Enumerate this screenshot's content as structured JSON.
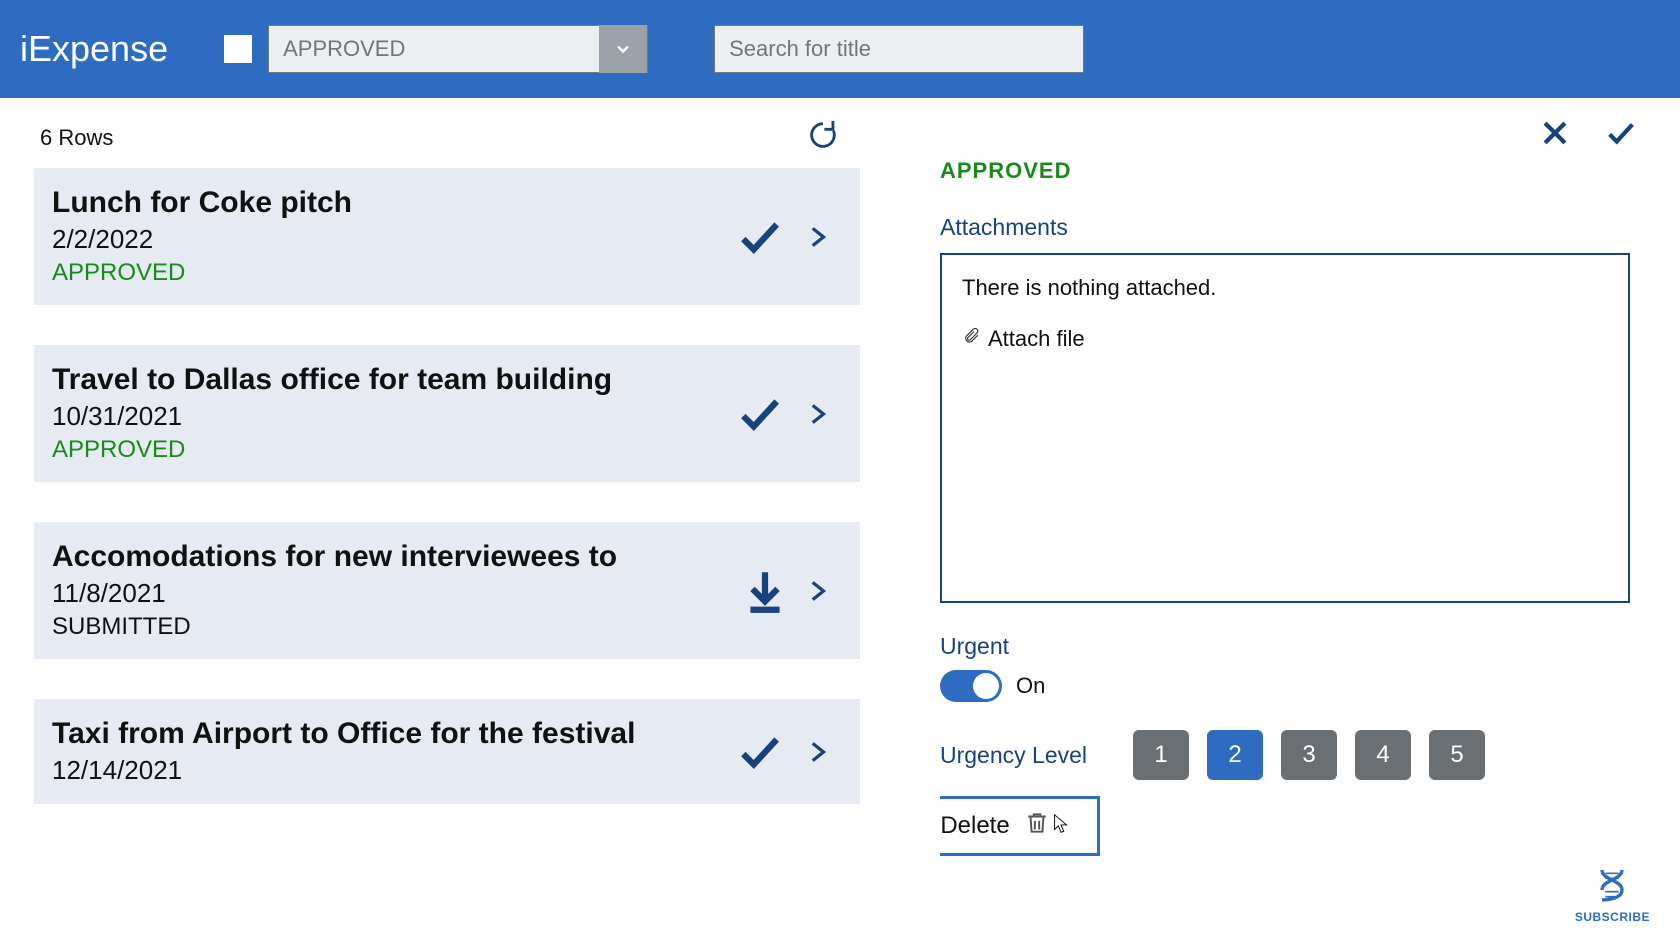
{
  "app": {
    "title": "iExpense"
  },
  "header": {
    "filter_placeholder": "APPROVED",
    "search_placeholder": "Search for title"
  },
  "list": {
    "row_count_label": "6 Rows",
    "items": [
      {
        "title": "Lunch for Coke pitch",
        "date": "2/2/2022",
        "status": "APPROVED",
        "status_class": "approved",
        "action_icon": "check"
      },
      {
        "title": "Travel to Dallas office for team building",
        "date": "10/31/2021",
        "status": "APPROVED",
        "status_class": "approved",
        "action_icon": "check"
      },
      {
        "title": "Accomodations for new interviewees to",
        "date": "11/8/2021",
        "status": "SUBMITTED",
        "status_class": "submitted",
        "action_icon": "download"
      },
      {
        "title": "Taxi from Airport to Office for the festival",
        "date": "12/14/2021",
        "status": "",
        "status_class": "approved",
        "action_icon": "check"
      }
    ]
  },
  "detail": {
    "status": "APPROVED",
    "attachments_label": "Attachments",
    "attachments_empty": "There is nothing attached.",
    "attach_file_label": "Attach file",
    "urgent_label": "Urgent",
    "urgent_state": "On",
    "urgency_level_label": "Urgency Level",
    "levels": [
      "1",
      "2",
      "3",
      "4",
      "5"
    ],
    "selected_level": "2",
    "delete_label": "Delete"
  },
  "subscribe": {
    "label": "SUBSCRIBE"
  },
  "colors": {
    "primary": "#2d6cc0",
    "navy": "#19427d",
    "approved": "#1a8a1a"
  }
}
